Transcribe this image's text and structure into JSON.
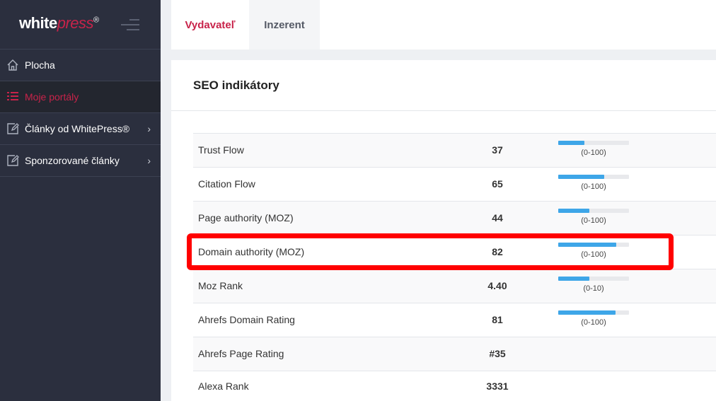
{
  "brand": {
    "white": "white",
    "press": "press",
    "reg": "®"
  },
  "sidebar": {
    "items": [
      {
        "label": "Plocha",
        "icon": "home-icon",
        "active": false
      },
      {
        "label": "Moje portály",
        "icon": "list-icon",
        "active": true
      },
      {
        "label": "Články od WhitePress®",
        "icon": "edit-icon",
        "chevron": "›"
      },
      {
        "label": "Sponzorované články",
        "icon": "edit-icon",
        "chevron": "›"
      }
    ]
  },
  "tabs": [
    {
      "label": "Vydavateľ",
      "active": true
    },
    {
      "label": "Inzerent",
      "active": false
    }
  ],
  "panel": {
    "title": "SEO indikátory",
    "rows": [
      {
        "name": "Trust Flow",
        "value": "37",
        "fill": 0.37,
        "range": "(0-100)"
      },
      {
        "name": "Citation Flow",
        "value": "65",
        "fill": 0.65,
        "range": "(0-100)"
      },
      {
        "name": "Page authority (MOZ)",
        "value": "44",
        "fill": 0.44,
        "range": "(0-100)"
      },
      {
        "name": "Domain authority (MOZ)",
        "value": "82",
        "fill": 0.82,
        "range": "(0-100)"
      },
      {
        "name": "Moz Rank",
        "value": "4.40",
        "fill": 0.44,
        "range": "(0-10)"
      },
      {
        "name": "Ahrefs Domain Rating",
        "value": "81",
        "fill": 0.81,
        "range": "(0-100)"
      },
      {
        "name": "Ahrefs Page Rating",
        "value": "#35"
      },
      {
        "name": "Alexa Rank",
        "value": "3331"
      }
    ]
  },
  "colors": {
    "accent": "#c8234a",
    "sidebar": "#2b2f3e",
    "bar": "#3ea6e8",
    "highlight": "#ff0000"
  }
}
